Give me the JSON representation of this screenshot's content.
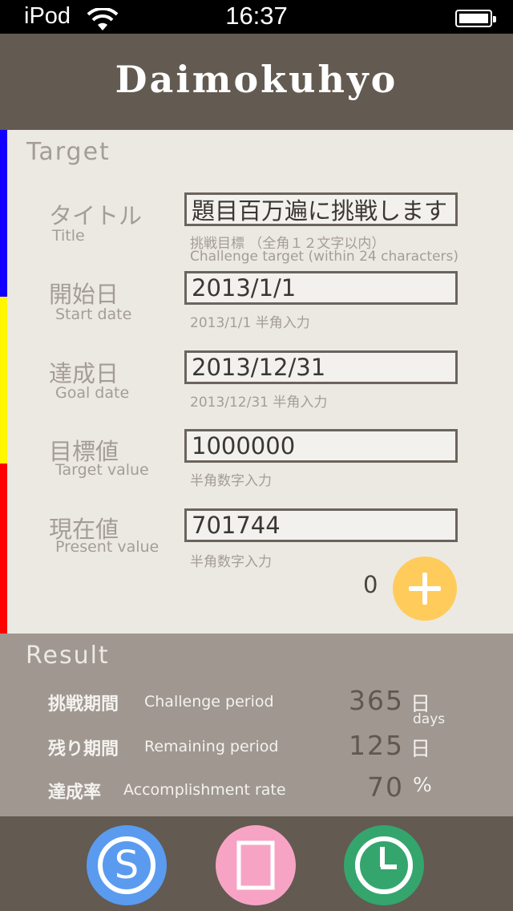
{
  "status_bar": {
    "device": "iPod",
    "time": "16:37"
  },
  "header": {
    "title": "Daimokuhyo"
  },
  "target": {
    "section_title": "Target",
    "fields": [
      {
        "label_jp": "タイトル",
        "label_en": "Title",
        "value": "題目百万遍に挑戦します",
        "hint_jp": "挑戦目標 （全角１２文字以内）",
        "hint_en": "Challenge target (within 24 characters)"
      },
      {
        "label_jp": "開始日",
        "label_en": "Start date",
        "value": "2013/1/1",
        "hint_jp": "2013/1/1 半角入力"
      },
      {
        "label_jp": "達成日",
        "label_en": "Goal date",
        "value": "2013/12/31",
        "hint_jp": "2013/12/31 半角入力"
      },
      {
        "label_jp": "目標値",
        "label_en": "Target value",
        "value": "1000000",
        "hint_jp": "半角数字入力"
      },
      {
        "label_jp": "現在値",
        "label_en": "Present value",
        "value": "701744",
        "hint_jp": "半角数字入力"
      }
    ],
    "counter": "0"
  },
  "result": {
    "section_title": "Result",
    "rows": [
      {
        "label_jp": "挑戦期間",
        "label_en": "Challenge period",
        "value": "365",
        "unit": "日",
        "unit_sub": "days"
      },
      {
        "label_jp": "残り期間",
        "label_en": "Remaining period",
        "value": "125",
        "unit": "日"
      },
      {
        "label_jp": "達成率",
        "label_en": "Accomplishment rate",
        "value": "70",
        "unit": "%"
      }
    ]
  },
  "toolbar": {
    "buttons": [
      {
        "icon": "s-circle-icon",
        "color": "#5a9bf0"
      },
      {
        "icon": "document-icon",
        "color": "#f7a4c4"
      },
      {
        "icon": "clock-icon",
        "color": "#35a56e"
      }
    ]
  },
  "colors": {
    "header": "#635a51",
    "strip_blue": "#1200ff",
    "strip_yellow": "#fff600",
    "strip_red": "#ff0000",
    "add_button": "#ffcb5a"
  }
}
